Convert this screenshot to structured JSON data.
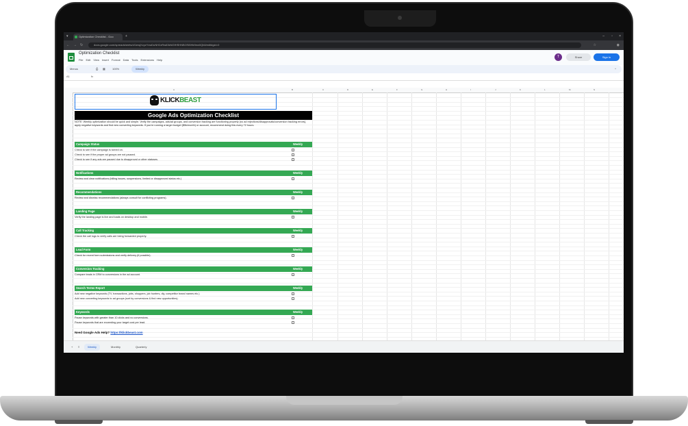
{
  "browser": {
    "tab_title": "Optimization Checklist - Goo",
    "url": "docs.google.com/spreadsheets/d/1ewjXzyzYxwDuNH2zRw63kNGfHSHNBOSi5Hk9ew0Qh8/edit#gid=0"
  },
  "app": {
    "doc_title": "Optimization Checklist",
    "menu": [
      "File",
      "Edit",
      "View",
      "Insert",
      "Format",
      "Data",
      "Tools",
      "Extensions",
      "Help"
    ],
    "avatar_letter": "T",
    "share_label": "Share",
    "signin_label": "Sign in"
  },
  "toolbar": {
    "menus": "Menus",
    "zoom": "100%",
    "weekly_tab": "Weekly"
  },
  "formula": {
    "cell_ref": "A1"
  },
  "columns": [
    "A",
    "B",
    "C",
    "D",
    "E",
    "F",
    "G",
    "H",
    "I",
    "J",
    "K",
    "L",
    "M",
    "N"
  ],
  "sheet": {
    "logo_left": "KLICK",
    "logo_right": "BEAST",
    "title": "Google Ads Optimization Checklist",
    "note": "NOTE: Weekly optimization should be quick and simple. Verify the campaigns, ads/ad groups, and conversion tracking are functioning properly (no ad rejections/disapprovals/conversion tracking errors), apply negative keywords and find new converting keywords. If you're running a larger budget ($5k/month) or account, recommend doing this every 72 hours.",
    "frequency_label": "Weekly",
    "sections": [
      {
        "name": "Campaign Status",
        "items": [
          "Check to see if the campaign is turned on.",
          "Check to see if the proper ad groups are not paused.",
          "Check to see if any ads are paused due to disapproval or other statuses."
        ]
      },
      {
        "name": "Notifications",
        "items": [
          "Review and clear notifications (billing issues, suspensions, limited or disapproved status etc.)"
        ]
      },
      {
        "name": "Recommendations",
        "items": [
          "Review and dismiss recommendations (always consult for conflicting programs)."
        ]
      },
      {
        "name": "Landing Page",
        "items": [
          "Verify the landing page is live and loads on desktop and mobile."
        ]
      },
      {
        "name": "Call Tracking",
        "items": [
          "Check the call logs to verify calls are being forwarded properly."
        ]
      },
      {
        "name": "Lead Form",
        "items": [
          "Check for recent form submissions and verify delivery (if possible)."
        ]
      },
      {
        "name": "Conversion Tracking",
        "items": [
          "Compare leads in CRM to conversions in the ad account."
        ]
      },
      {
        "name": "Search Terms Report",
        "items": [
          "Add new negative keywords (TV, transactions, jobs, shoppers, job hunters, diy, competitor brand names etc.)",
          "Add new converting keywords to ad groups (sort by conversions & find new opportunities)."
        ]
      },
      {
        "name": "Keywords",
        "items": [
          "Pause keywords with greater than 10 clicks and no conversions.",
          "Pause keywords that are exceeding your target cost per lead."
        ]
      }
    ],
    "footer_text": "Need Google Ads Help?",
    "footer_link": "https://klickbeast.com"
  },
  "sheet_tabs": [
    "Weekly",
    "Monthly",
    "Quarterly"
  ],
  "colors": {
    "section_green": "#34a853",
    "title_black": "#000000",
    "share_blue": "#1a73e8"
  }
}
